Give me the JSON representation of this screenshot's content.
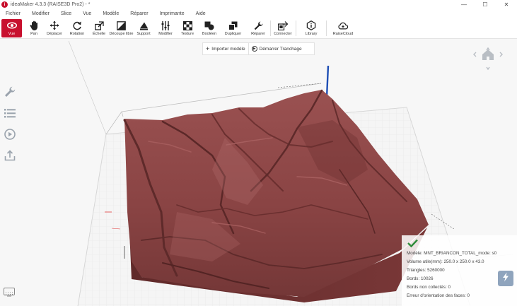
{
  "window": {
    "title": "ideaMaker 4.3.3 (RAISE3D Pro2) - *",
    "logo_letter": "i",
    "controls": [
      "—",
      "☐",
      "✕"
    ]
  },
  "menu": [
    "Fichier",
    "Modifier",
    "Slice",
    "Vue",
    "Modèle",
    "Réparer",
    "Imprimante",
    "Aide"
  ],
  "toolbar": {
    "tools": [
      {
        "id": "vue",
        "label": "Vue",
        "icon": "eye-icon",
        "active": true
      },
      {
        "id": "pan",
        "label": "Pan",
        "icon": "hand-icon"
      },
      {
        "id": "deplacer",
        "label": "Déplacer",
        "icon": "move-icon"
      },
      {
        "id": "rotation",
        "label": "Rotation",
        "icon": "rotate-icon"
      },
      {
        "id": "echelle",
        "label": "Échelle",
        "icon": "scale-icon"
      },
      {
        "id": "decoupe",
        "label": "Découpe libre",
        "icon": "cut-icon"
      },
      {
        "id": "support",
        "label": "Support",
        "icon": "support-icon"
      },
      {
        "id": "modifier",
        "label": "Modifier",
        "icon": "sliders-icon"
      },
      {
        "id": "texture",
        "label": "Texture",
        "icon": "texture-icon"
      },
      {
        "id": "booleen",
        "label": "Booléen",
        "icon": "boolean-icon"
      },
      {
        "id": "dupliquer",
        "label": "Dupliquer",
        "icon": "duplicate-icon"
      },
      {
        "id": "reparer",
        "label": "Réparer",
        "icon": "wrench-icon"
      },
      {
        "id": "connecter",
        "label": "Connecter",
        "icon": "connect-icon"
      },
      {
        "id": "library",
        "label": "Library",
        "icon": "info-icon"
      },
      {
        "id": "raisecloud",
        "label": "RaiseCloud",
        "icon": "cloud-icon"
      }
    ]
  },
  "import_bar": {
    "import_label": "Importer modèle",
    "start_label": "Démarrer Tranchage"
  },
  "sidebar": [
    "wrench-icon",
    "list-icon",
    "play-icon",
    "upload-icon"
  ],
  "model_info": {
    "model": "Modèle: MNT_BRIANCON_TOTAL_mode: s0",
    "volume": "Volume utile(mm): 250.0 x 250.0 x 43.0",
    "triangles": "Triangles: 5260000",
    "edges": "Bords: 10026",
    "non_manifold": "Bords non collectés: 0",
    "orientation_errors": "Erreur d'orientation des faces: 0"
  },
  "colors": {
    "accent": "#c8102e",
    "terrain": "#8a4444",
    "bed_grid": "#d9d9d9",
    "z_axis": "#1f4fb5",
    "check": "#2e8b3a"
  }
}
